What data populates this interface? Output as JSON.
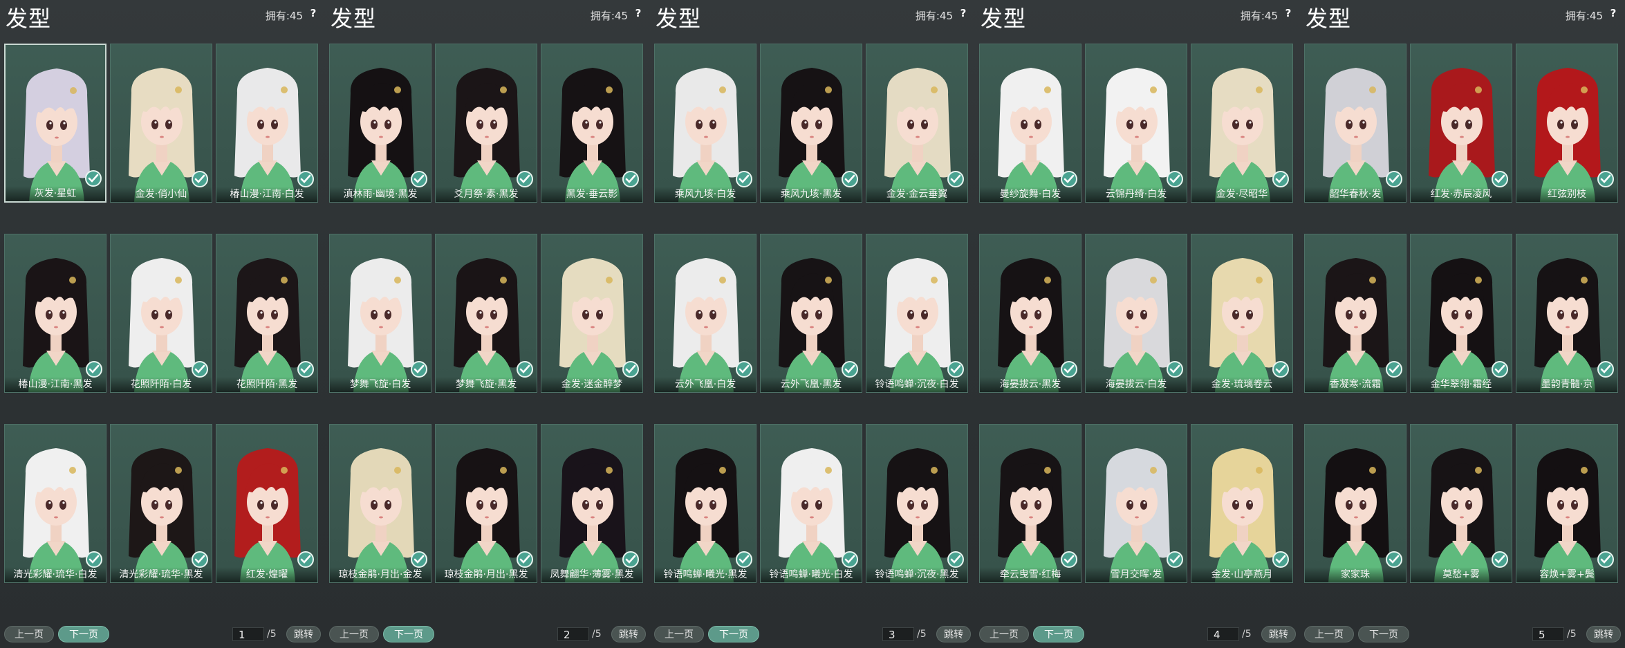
{
  "panels": [
    {
      "title": "发型",
      "owned": "拥有:45",
      "help": "?",
      "items": [
        "灰发·星虹",
        "金发·俏小仙",
        "椿山漫·江南·白发",
        "椿山漫·江南·黑发",
        "花照阡陌·白发",
        "花照阡陌·黑发",
        "清光彩耀·琉华·白发",
        "清光彩耀·琉华·黑发",
        "红发·煌曜"
      ],
      "hair_colors": [
        "#d4cfe0",
        "#e7dcc2",
        "#e9e9ea",
        "#1a1416",
        "#eeeeee",
        "#1c1618",
        "#f0f0f0",
        "#1d1717",
        "#b21d1d"
      ],
      "selected_index": 0,
      "prev_label": "上一页",
      "next_label": "下一页",
      "page_value": "1",
      "page_total": "/5",
      "jump_label": "跳转"
    },
    {
      "title": "发型",
      "owned": "拥有:45",
      "help": "?",
      "items": [
        "滇林雨·幽境·黑发",
        "爻月祭·素·黑发",
        "黑发·垂云影",
        "梦舞飞旋·白发",
        "梦舞飞旋·黑发",
        "金发·迷金醉梦",
        "琼枝金鹃·月出·金发",
        "琼枝金鹃·月出·黑发",
        "凤舞翩华·薄雾·黑发"
      ],
      "hair_colors": [
        "#151113",
        "#1b1517",
        "#161214",
        "#ececec",
        "#1a1416",
        "#e5dcc0",
        "#e3d8b8",
        "#171214",
        "#19131a"
      ],
      "selected_index": -1,
      "prev_label": "上一页",
      "next_label": "下一页",
      "page_value": "2",
      "page_total": "/5",
      "jump_label": "跳转"
    },
    {
      "title": "发型",
      "owned": "拥有:45",
      "help": "?",
      "items": [
        "乘风九垓·白发",
        "乘风九垓·黑发",
        "金发·金云垂翼",
        "云外飞凰·白发",
        "云外飞凰·黑发",
        "铃语鸣蝉·沉夜·白发",
        "铃语鸣蝉·曦光·黑发",
        "铃语鸣蝉·曦光·白发",
        "铃语鸣蝉·沉夜·黑发"
      ],
      "hair_colors": [
        "#e9e9e9",
        "#161214",
        "#e4dbc3",
        "#ececec",
        "#171315",
        "#eeeeee",
        "#151113",
        "#efefef",
        "#161214"
      ],
      "selected_index": -1,
      "prev_label": "上一页",
      "next_label": "下一页",
      "page_value": "3",
      "page_total": "/5",
      "jump_label": "跳转"
    },
    {
      "title": "发型",
      "owned": "拥有:45",
      "help": "?",
      "items": [
        "曼纱旋舞·白发",
        "云锦丹绮·白发",
        "金发·尽昭华",
        "海晏拔云·黑发",
        "海晏拔云·白发",
        "金发·琉璃卷云",
        "牵云曳雪·红梅",
        "雪月交晖·发",
        "金发·山亭燕月"
      ],
      "hair_colors": [
        "#f0f0f0",
        "#f2f2f2",
        "#e6dcc2",
        "#161214",
        "#d9d9dc",
        "#e7d9ae",
        "#171315",
        "#d6d9de",
        "#e6d49a"
      ],
      "selected_index": -1,
      "prev_label": "上一页",
      "next_label": "下一页",
      "page_value": "4",
      "page_total": "/5",
      "jump_label": "跳转"
    },
    {
      "title": "发型",
      "owned": "拥有:45",
      "help": "?",
      "items": [
        "韶华春秋·发",
        "红发·赤辰凌风",
        "红弦别枝",
        "香凝寒·流霜",
        "金华翠翎·霜经",
        "墨韵青髓·京",
        "家家珠",
        "莫愁+雾",
        "容焕+雾+鬓"
      ],
      "hair_colors": [
        "#d0d0d6",
        "#a9191c",
        "#b3181b",
        "#1b1517",
        "#151113",
        "#161214",
        "#141012",
        "#171315",
        "#141012"
      ],
      "selected_index": -1,
      "prev_label": "上一页",
      "next_label": "下一页",
      "page_value": "5",
      "page_total": "/5",
      "jump_label": "跳转"
    }
  ],
  "colors": {
    "accent": "#5d9a8a",
    "card_bg": "#3e5d54",
    "outfit": "#5fba7d"
  }
}
